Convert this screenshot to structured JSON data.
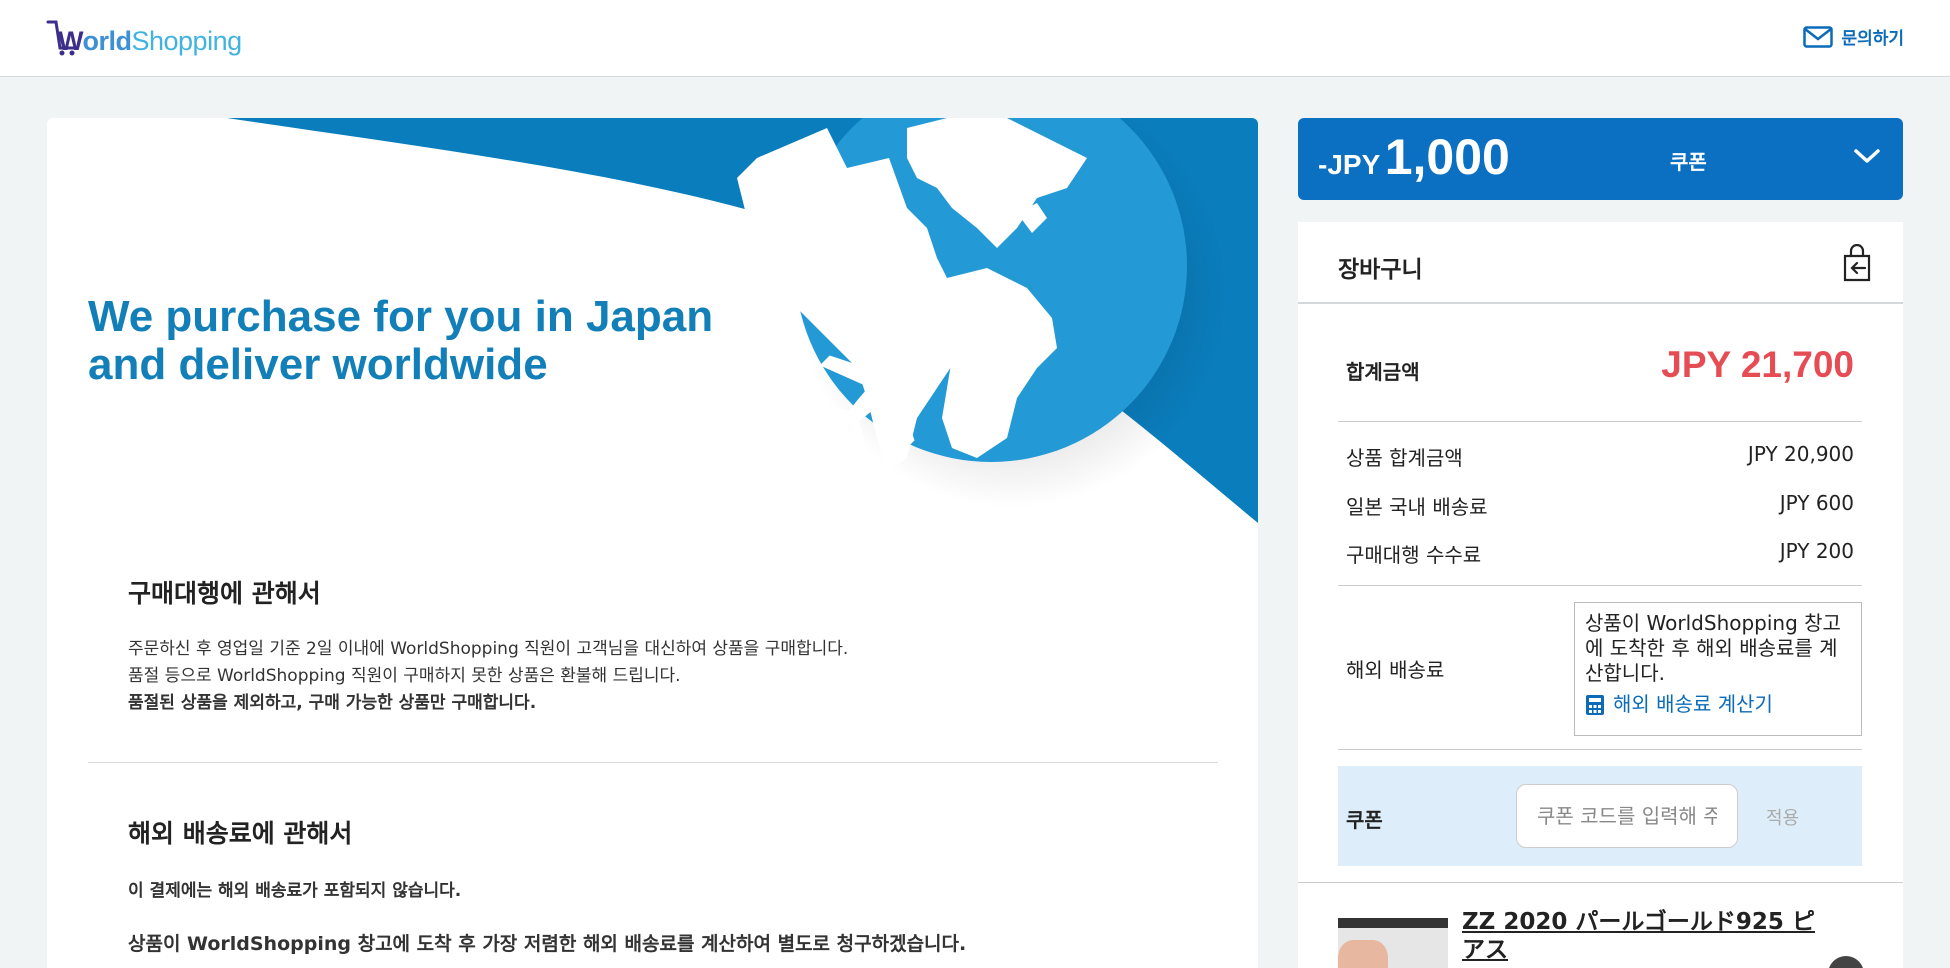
{
  "header": {
    "logo_prefix": "W",
    "logo_mid": "orld",
    "logo_suffix": "Shopping",
    "contact_label": "문의하기"
  },
  "hero": {
    "title_line1": "We purchase for you in Japan",
    "title_line2": "and deliver worldwide"
  },
  "sections": {
    "purchase": {
      "title": "구매대행에 관해서",
      "line1": "주문하신 후 영업일 기준 2일 이내에 WorldShopping 직원이 고객님을 대신하여 상품을 구매합니다.",
      "line2": "품절 등으로 WorldShopping 직원이 구매하지 못한 상품은 환불해 드립니다.",
      "warning": "품절된 상품을 제외하고, 구매 가능한 상품만 구매합니다."
    },
    "shipping": {
      "title": "해외 배송료에 관해서",
      "warning": "이 결제에는 해외 배송료가 포함되지 않습니다.",
      "note": "상품이 WorldShopping 창고에 도착 후 가장 저렴한 해외 배송료를 계산하여 별도로 청구하겠습니다."
    }
  },
  "coupon_bar": {
    "prefix": "-JPY",
    "amount": "1,000",
    "label": "쿠폰"
  },
  "cart": {
    "title": "장바구니",
    "total_label": "합계금액",
    "total_value": "JPY 21,700",
    "rows": [
      {
        "label": "상품 합계금액",
        "value": "JPY 20,900"
      },
      {
        "label": "일본 국내 배송료",
        "value": "JPY 600"
      },
      {
        "label": "구매대행 수수료",
        "value": "JPY 200"
      }
    ],
    "intl_shipping_label": "해외 배송료",
    "intl_shipping_note": "상품이 WorldShopping 창고에 도착한 후 해외 배송료를 계산합니다.",
    "calculator_label": "해외 배송료 계산기",
    "coupon_label": "쿠폰",
    "coupon_placeholder": "쿠폰 코드를 입력해 주세요",
    "apply_label": "적용",
    "product_name": "ZZ 2020 パールゴールド925 ピアス"
  },
  "colors": {
    "brand_blue": "#0b6fc2",
    "hero_blue": "#127fb8",
    "accent_red": "#e64c53",
    "coupon_bg": "#ddeefa"
  }
}
